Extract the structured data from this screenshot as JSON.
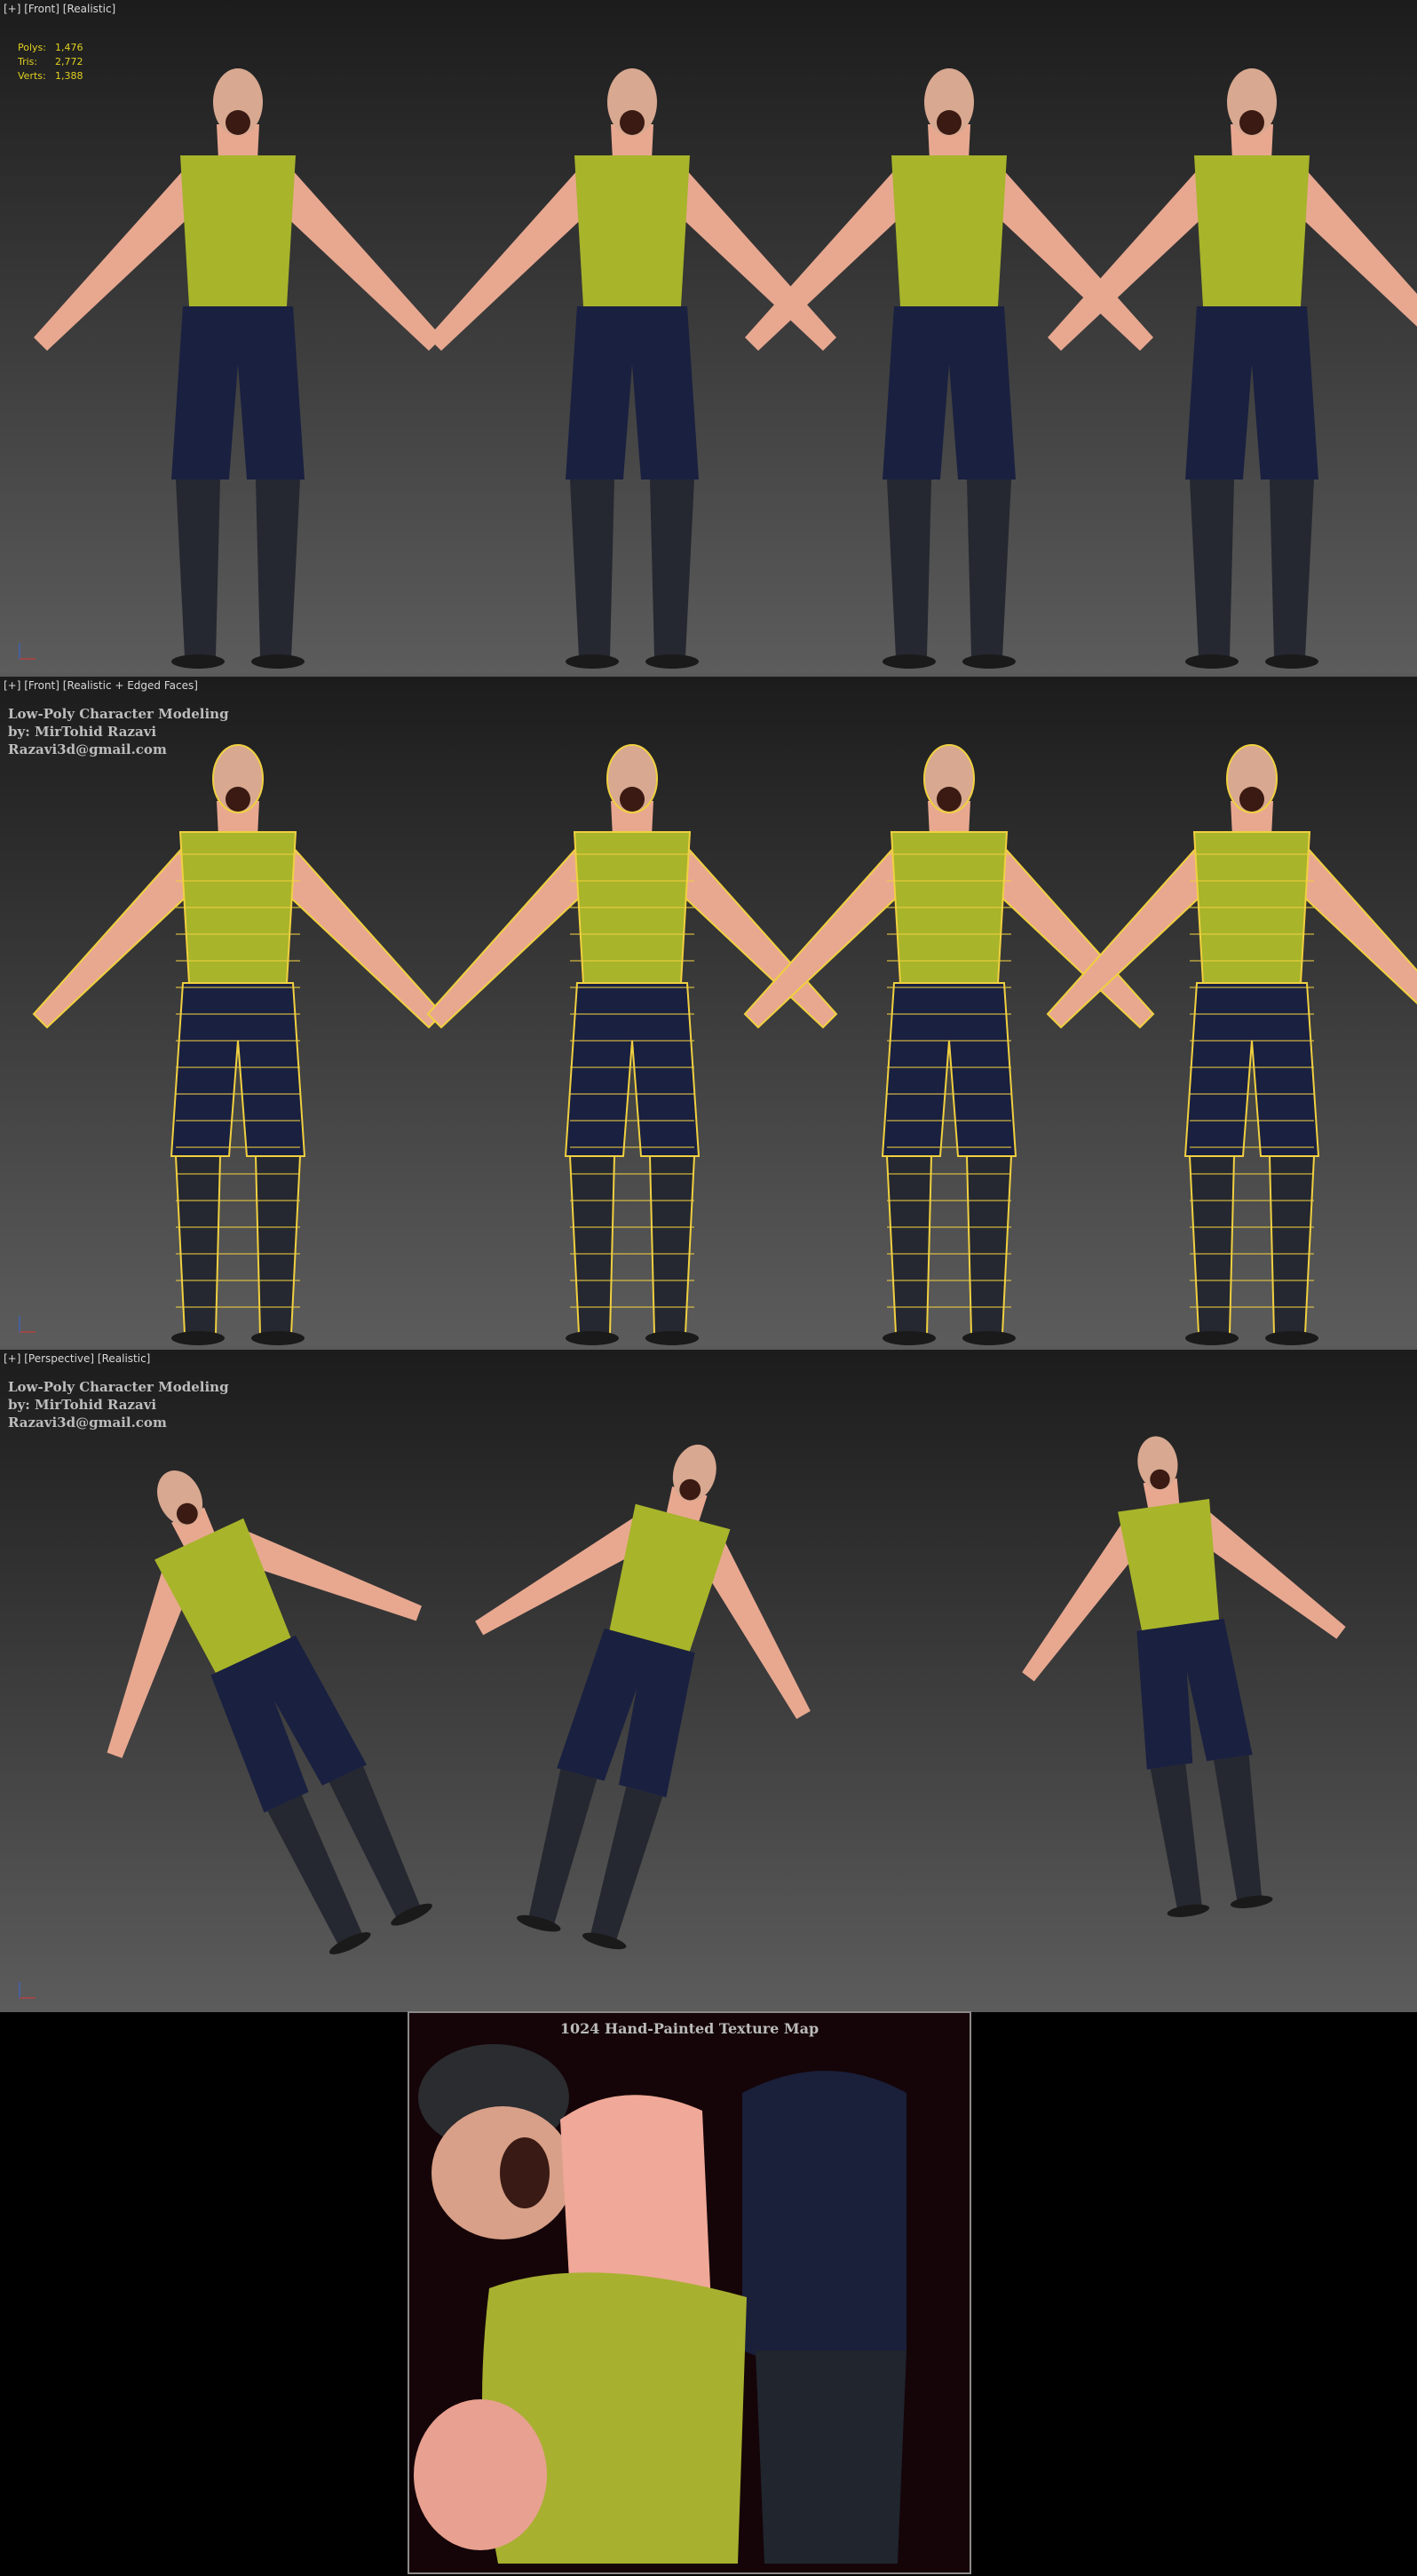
{
  "viewports": [
    {
      "label": "[+] [Front] [Realistic]",
      "stats": [
        {
          "k": "Polys:",
          "v": "1,476"
        },
        {
          "k": "Tris:",
          "v": "2,772"
        },
        {
          "k": "Verts:",
          "v": "1,388"
        }
      ]
    },
    {
      "label": "[+] [Front] [Realistic + Edged Faces]"
    },
    {
      "label": "[+] [Perspective] [Realistic]"
    }
  ],
  "credits": {
    "title": "Low-Poly Character Modeling",
    "author": "by: MirTohid Razavi",
    "email": "Razavi3d@gmail.com"
  },
  "texture": {
    "title": "1024  Hand-Painted Texture Map"
  },
  "colors": {
    "shirt": "#a8b42a",
    "pants": "#1a2040",
    "skin": "#e8a890",
    "boots": "#252830",
    "wire": "#f0d040"
  }
}
